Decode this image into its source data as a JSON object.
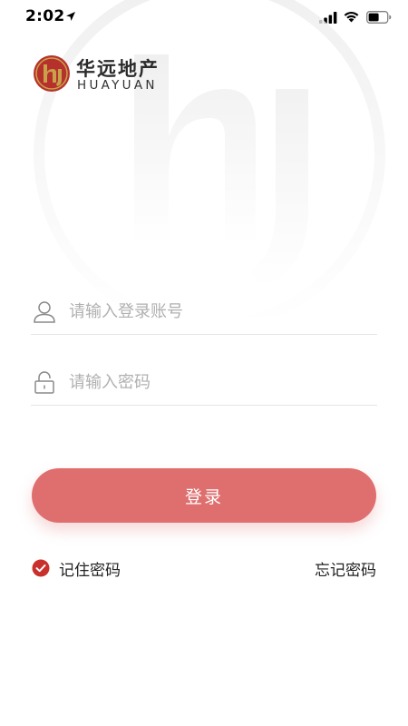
{
  "status_bar": {
    "time": "2:02",
    "icons": [
      "location-arrow-icon",
      "cellular-signal-icon",
      "wifi-icon",
      "battery-icon"
    ]
  },
  "logo": {
    "name_cn": "华远地产",
    "name_en": "HUAYUAN",
    "mark_letters": "hy"
  },
  "form": {
    "account": {
      "placeholder": "请输入登录账号",
      "value": "",
      "icon": "user-icon"
    },
    "password": {
      "placeholder": "请输入密码",
      "value": "",
      "icon": "lock-icon"
    },
    "login_label": "登录",
    "remember_label": "记住密码",
    "remember_checked": true,
    "forgot_label": "忘记密码"
  },
  "colors": {
    "primary": "#df6f6f",
    "check": "#c9302c",
    "logo_red": "#b7312c",
    "logo_gold": "#c8a24a",
    "placeholder": "#b0b0b0"
  }
}
